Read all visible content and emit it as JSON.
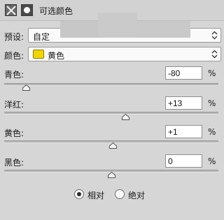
{
  "header": {
    "title": "可选颜色"
  },
  "preset": {
    "label": "预设:",
    "value": "自定"
  },
  "colors": {
    "label": "颜色:",
    "value": "黄色",
    "swatch_color": "#f2d600"
  },
  "sliders": [
    {
      "label": "青色:",
      "value": "-80",
      "unit": "%",
      "level_percent": -80
    },
    {
      "label": "洋红:",
      "value": "+13",
      "unit": "%",
      "level_percent": 13
    },
    {
      "label": "黄色:",
      "value": "+1",
      "unit": "%",
      "level_percent": 1
    },
    {
      "label": "黑色:",
      "value": "0",
      "unit": "%",
      "level_percent": 0
    }
  ],
  "method": {
    "options": [
      "相对",
      "绝对"
    ],
    "selected": "相对"
  }
}
